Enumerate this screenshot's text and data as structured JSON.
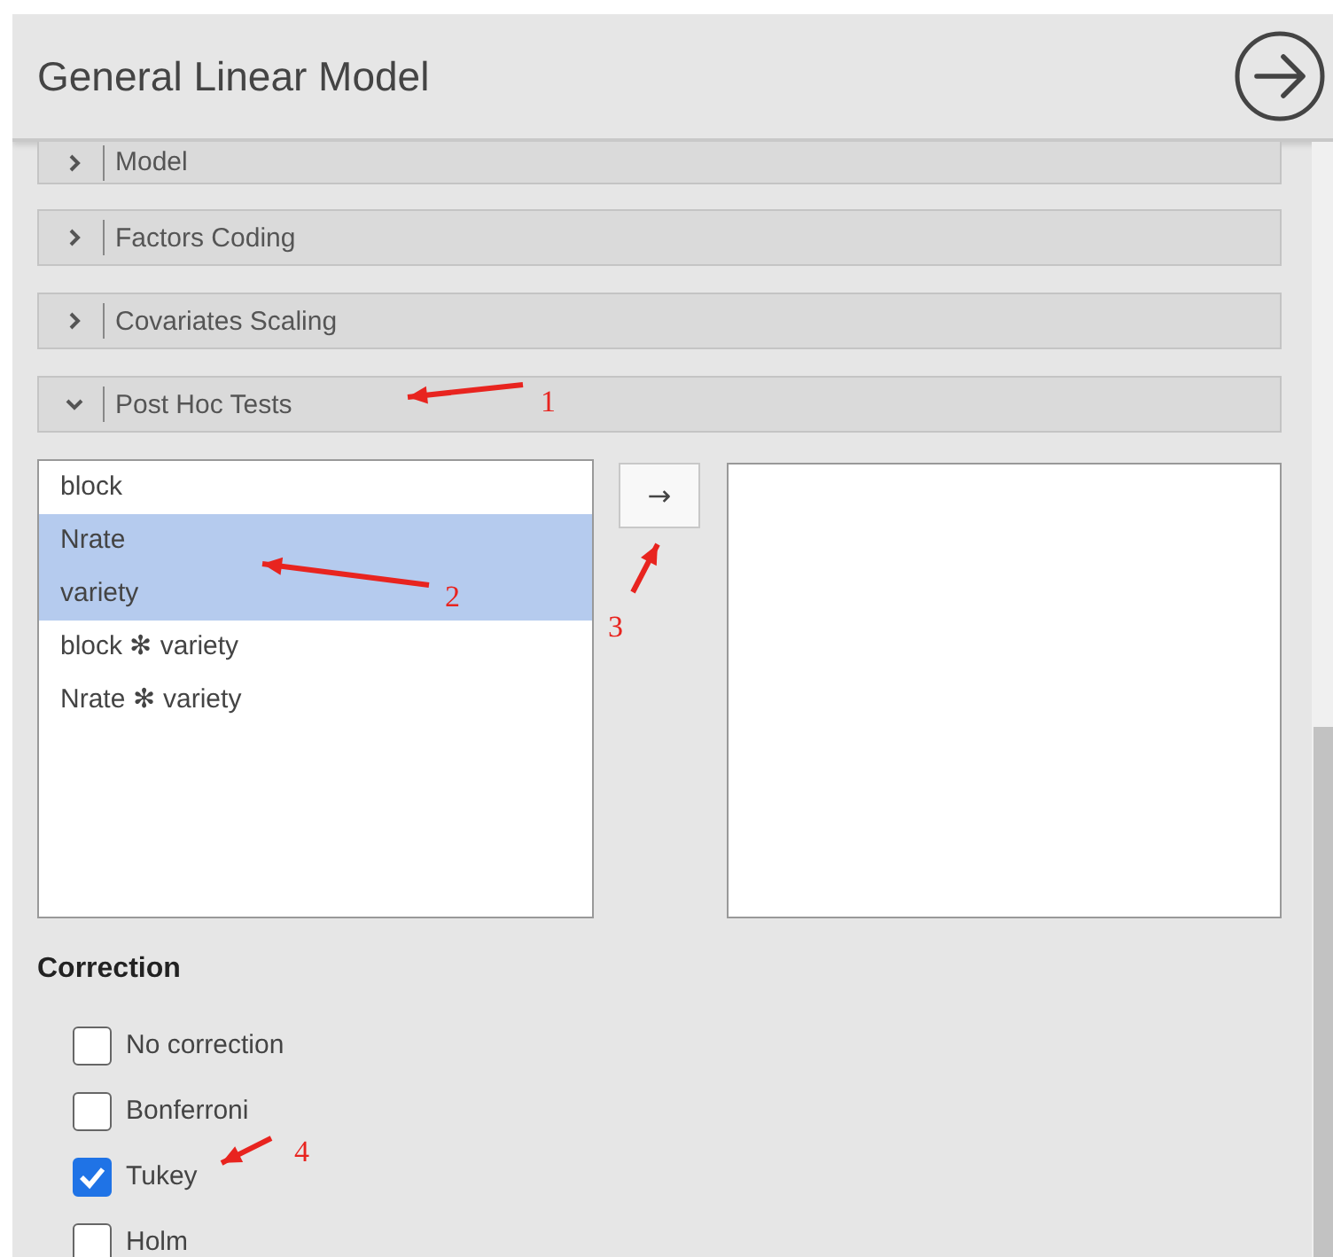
{
  "window": {
    "title": "General Linear Model"
  },
  "sections": [
    {
      "label": "Model",
      "expanded": false
    },
    {
      "label": "Factors Coding",
      "expanded": false
    },
    {
      "label": "Covariates Scaling",
      "expanded": false
    },
    {
      "label": "Post Hoc Tests",
      "expanded": true
    }
  ],
  "available_terms": [
    {
      "label": "block",
      "selected": false
    },
    {
      "label": "Nrate",
      "selected": true
    },
    {
      "label": "variety",
      "selected": true
    },
    {
      "label": "block ✻ variety",
      "selected": false
    },
    {
      "label": "Nrate ✻ variety",
      "selected": false
    }
  ],
  "move_button": {
    "label": "→"
  },
  "correction": {
    "heading": "Correction",
    "options": [
      {
        "label": "No correction",
        "checked": false
      },
      {
        "label": "Bonferroni",
        "checked": false
      },
      {
        "label": "Tukey",
        "checked": true
      },
      {
        "label": "Holm",
        "checked": false
      }
    ]
  },
  "annotations": [
    {
      "text": "1"
    },
    {
      "text": "2"
    },
    {
      "text": "3"
    },
    {
      "text": "4"
    }
  ]
}
